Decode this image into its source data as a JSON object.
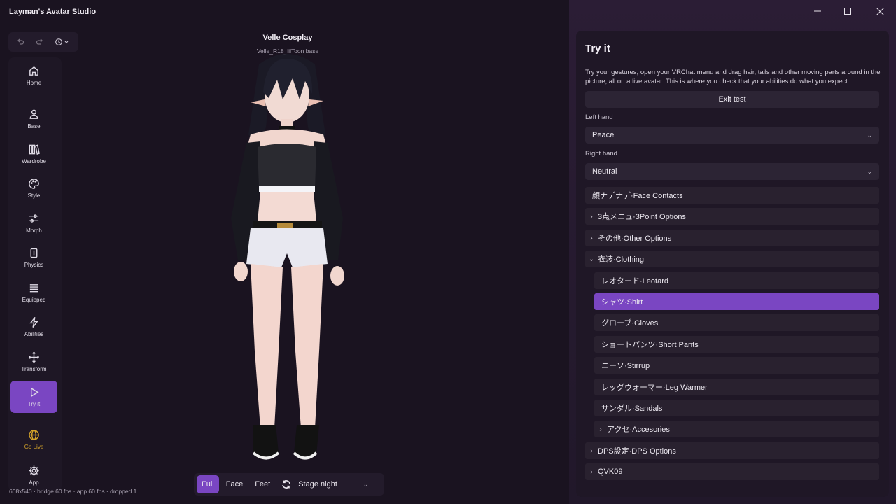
{
  "app": {
    "title": "Layman's Avatar Studio"
  },
  "history": {
    "undo_icon": "undo-icon",
    "redo_icon": "redo-icon",
    "history_icon": "history-icon"
  },
  "nav": [
    {
      "label": "Home",
      "icon": "home-icon"
    },
    {
      "label": "Base",
      "icon": "person-icon"
    },
    {
      "label": "Wardrobe",
      "icon": "wardrobe-icon"
    },
    {
      "label": "Style",
      "icon": "palette-icon"
    },
    {
      "label": "Morph",
      "icon": "sliders-icon"
    },
    {
      "label": "Physics",
      "icon": "physics-icon"
    },
    {
      "label": "Equipped",
      "icon": "list-icon"
    },
    {
      "label": "Abilities",
      "icon": "bolt-icon"
    },
    {
      "label": "Transform",
      "icon": "move-icon"
    },
    {
      "label": "Try it",
      "icon": "play-icon"
    },
    {
      "label": "Go Live",
      "icon": "globe-icon"
    },
    {
      "label": "App",
      "icon": "gear-icon"
    }
  ],
  "viewport": {
    "avatar_name": "Velle Cosplay",
    "avatar_base": "Velle_R18_lilToon base",
    "stats": "608x540 · bridge 60 fps · app 60 fps · dropped 1"
  },
  "view_bar": {
    "full": "Full",
    "face": "Face",
    "feet": "Feet",
    "stage": "Stage night"
  },
  "panel": {
    "title": "Try it",
    "description": "Try your gestures, open your VRChat menu and drag hair, tails and other moving parts around in the picture, all on a live avatar. This is where you check that your abilities do what you expect.",
    "exit_label": "Exit test",
    "left_hand_label": "Left hand",
    "left_hand_value": "Peace",
    "right_hand_label": "Right hand",
    "right_hand_value": "Neutral",
    "menu": [
      {
        "label": "顔ナデナデ·Face Contacts",
        "arrow": "",
        "indent": 0
      },
      {
        "label": "3点メニュ·3Point Options",
        "arrow": "›",
        "indent": 0
      },
      {
        "label": "その他·Other Options",
        "arrow": "›",
        "indent": 0
      },
      {
        "label": "衣装·Clothing",
        "arrow": "⌄",
        "indent": 0
      },
      {
        "label": "レオタード·Leotard",
        "arrow": "",
        "indent": 1
      },
      {
        "label": "シャツ·Shirt",
        "arrow": "",
        "indent": 1,
        "selected": true
      },
      {
        "label": "グローブ·Gloves",
        "arrow": "",
        "indent": 1
      },
      {
        "label": "ショートパンツ·Short Pants",
        "arrow": "",
        "indent": 1
      },
      {
        "label": "ニーソ·Stirrup",
        "arrow": "",
        "indent": 1
      },
      {
        "label": "レッグウォーマー·Leg Warmer",
        "arrow": "",
        "indent": 1
      },
      {
        "label": "サンダル·Sandals",
        "arrow": "",
        "indent": 1
      },
      {
        "label": "アクセ·Accesories",
        "arrow": "›",
        "indent": 1
      },
      {
        "label": "DPS設定·DPS Options",
        "arrow": "›",
        "indent": 0
      },
      {
        "label": "QVK09",
        "arrow": "›",
        "indent": 0
      }
    ]
  },
  "colors": {
    "accent": "#7a46c2",
    "go_live": "#d6a52a",
    "background": "#1a1320"
  }
}
